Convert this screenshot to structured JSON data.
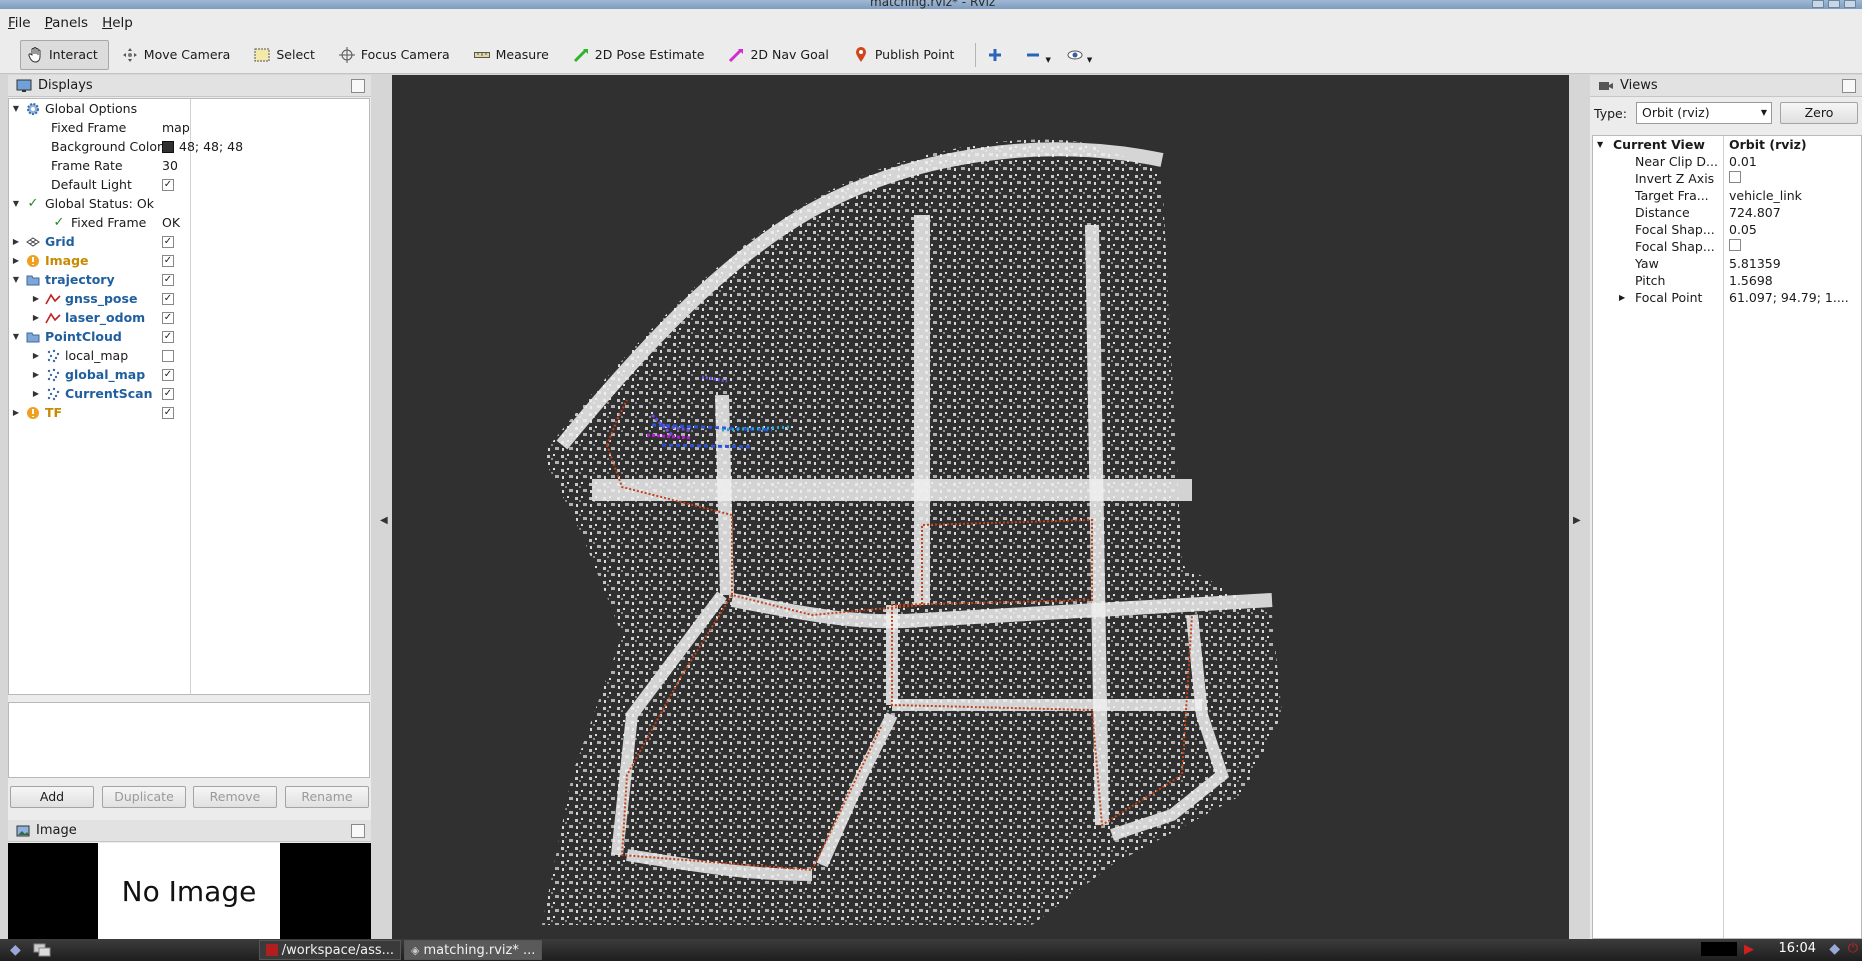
{
  "window": {
    "title": "matching.rviz* - RViz"
  },
  "menu": [
    "File",
    "Panels",
    "Help"
  ],
  "toolbar": {
    "tools": [
      {
        "label": "Interact",
        "icon": "hand-icon",
        "active": true
      },
      {
        "label": "Move Camera",
        "icon": "move-camera-icon",
        "active": false
      },
      {
        "label": "Select",
        "icon": "select-icon",
        "active": false
      },
      {
        "label": "Focus Camera",
        "icon": "focus-camera-icon",
        "active": false
      },
      {
        "label": "Measure",
        "icon": "ruler-icon",
        "active": false
      },
      {
        "label": "2D Pose Estimate",
        "icon": "pose-estimate-icon",
        "active": false
      },
      {
        "label": "2D Nav Goal",
        "icon": "nav-goal-icon",
        "active": false
      },
      {
        "label": "Publish Point",
        "icon": "pin-icon",
        "active": false
      }
    ]
  },
  "displays": {
    "title": "Displays",
    "rows": [
      {
        "label": "Global Options",
        "value": "",
        "expanded": true
      },
      {
        "label": "Fixed Frame",
        "value": "map"
      },
      {
        "label": "Background Color",
        "value": "48; 48; 48"
      },
      {
        "label": "Frame Rate",
        "value": "30"
      },
      {
        "label": "Default Light"
      },
      {
        "label": "Global Status: Ok"
      },
      {
        "label": "Fixed Frame",
        "value": "OK"
      },
      {
        "label": "Grid"
      },
      {
        "label": "Image"
      },
      {
        "label": "trajectory"
      },
      {
        "label": "gnss_pose"
      },
      {
        "label": "laser_odom"
      },
      {
        "label": "PointCloud"
      },
      {
        "label": "local_map"
      },
      {
        "label": "global_map"
      },
      {
        "label": "CurrentScan"
      },
      {
        "label": "TF"
      }
    ],
    "buttons": {
      "add": "Add",
      "duplicate": "Duplicate",
      "remove": "Remove",
      "rename": "Rename"
    }
  },
  "image_panel": {
    "title": "Image",
    "placeholder": "No Image"
  },
  "views": {
    "title": "Views",
    "type_label": "Type:",
    "type_value": "Orbit (rviz)",
    "zero_label": "Zero",
    "header": {
      "key": "Current View",
      "value": "Orbit (rviz)"
    },
    "props": [
      {
        "k": "Near Clip D...",
        "v": "0.01"
      },
      {
        "k": "Invert Z Axis",
        "v": ""
      },
      {
        "k": "Target Fra...",
        "v": "vehicle_link"
      },
      {
        "k": "Distance",
        "v": "724.807"
      },
      {
        "k": "Focal Shap...",
        "v": "0.05"
      },
      {
        "k": "Focal Shap...",
        "v": ""
      },
      {
        "k": "Yaw",
        "v": "5.81359"
      },
      {
        "k": "Pitch",
        "v": "1.5698"
      },
      {
        "k": "Focal Point",
        "v": "61.097; 94.79; 1...."
      }
    ]
  },
  "taskbar": {
    "tasks": [
      "/workspace/ass...",
      "matching.rviz* ..."
    ],
    "clock": "16:04"
  },
  "colors": {
    "background": "#303030",
    "trajectory": "#c0441c",
    "cloud": "#e8e8e8"
  }
}
